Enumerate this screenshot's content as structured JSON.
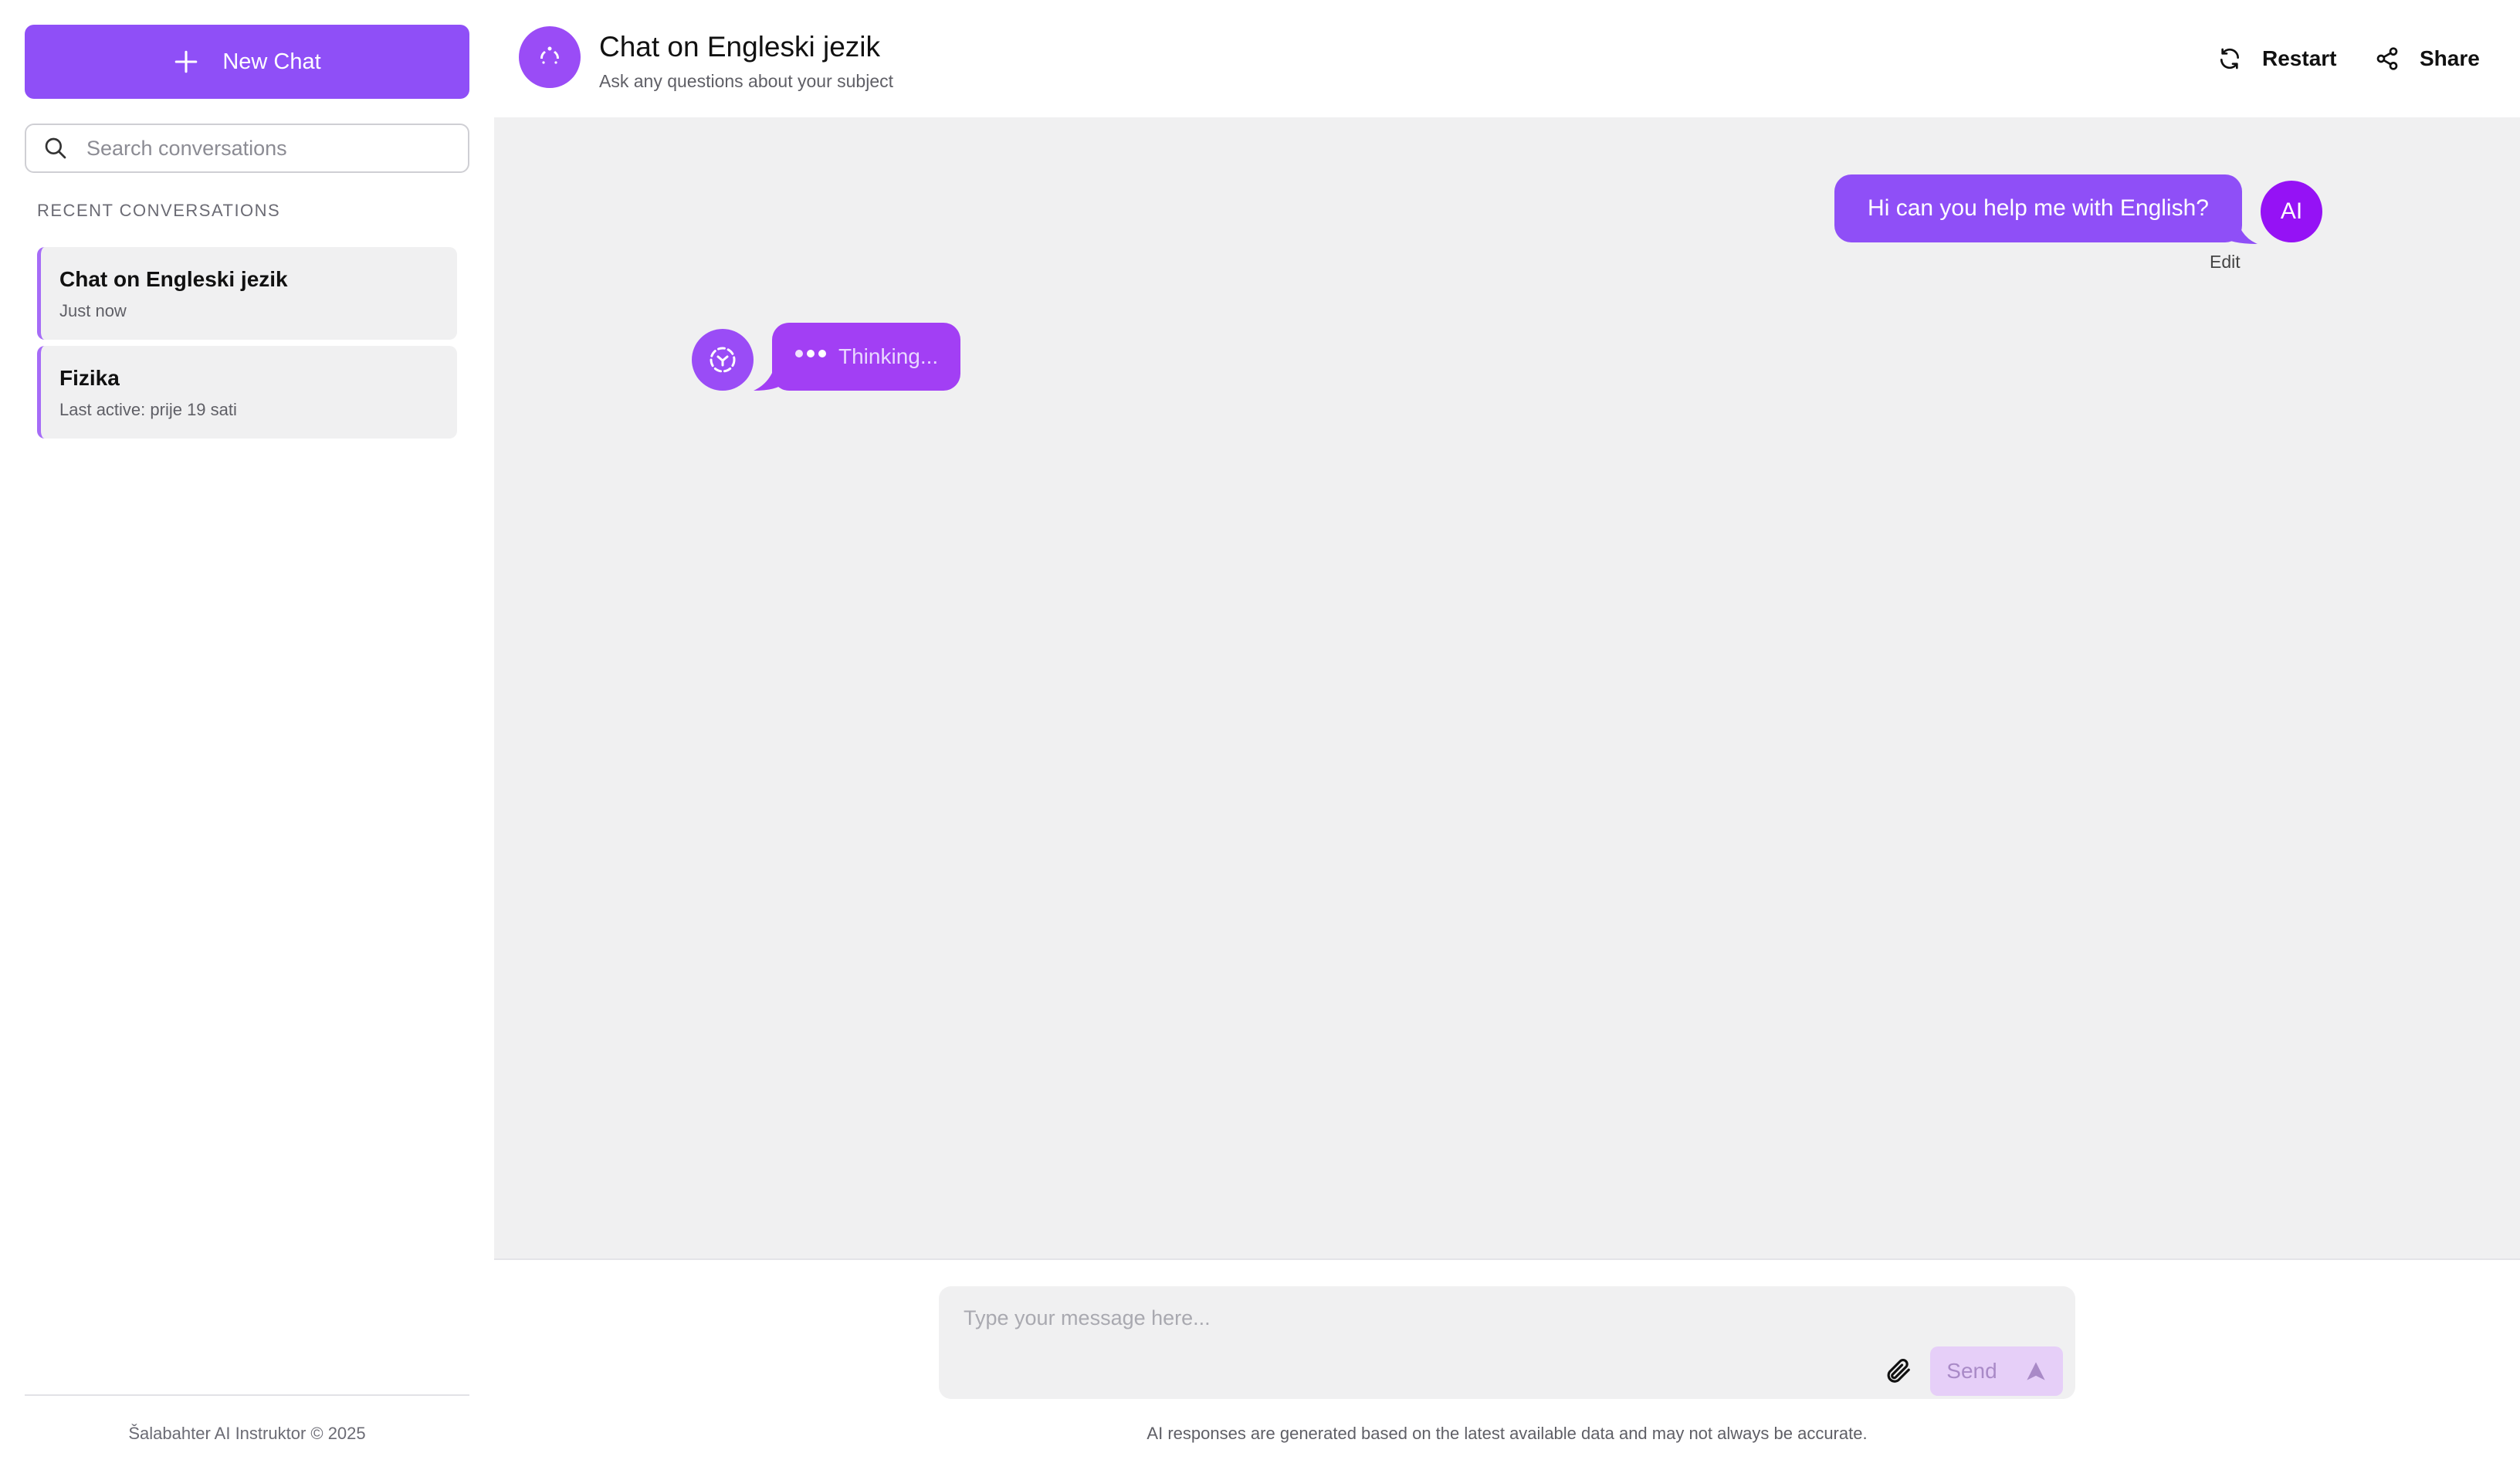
{
  "sidebar": {
    "new_chat_label": "New Chat",
    "search_placeholder": "Search conversations",
    "section_label": "RECENT CONVERSATIONS",
    "conversations": [
      {
        "title": "Chat on Engleski jezik",
        "meta": "Just now"
      },
      {
        "title": "Fizika",
        "meta": "Last active: prije 19 sati"
      }
    ],
    "footer": "Šalabahter AI Instruktor © 2025"
  },
  "header": {
    "title": "Chat on Engleski jezik",
    "subtitle": "Ask any questions about your subject",
    "restart_label": "Restart",
    "share_label": "Share"
  },
  "messages": {
    "user_text": "Hi can you help me with English?",
    "user_avatar_initials": "AI",
    "edit_label": "Edit",
    "bot_status": "Thinking..."
  },
  "composer": {
    "placeholder": "Type your message here...",
    "send_label": "Send",
    "disclaimer": "AI responses are generated based on the latest available data and may not always be accurate."
  },
  "colors": {
    "accent": "#8f4ff7",
    "bot_bubble": "#a23ff4",
    "user_avatar": "#9512f5",
    "chat_background": "#f0f0f1"
  },
  "icons": [
    "plus-icon",
    "search-icon",
    "brain-logo-icon",
    "refresh-icon",
    "share-icon",
    "paperclip-icon",
    "send-arrow-icon",
    "typing-dots-icon"
  ]
}
